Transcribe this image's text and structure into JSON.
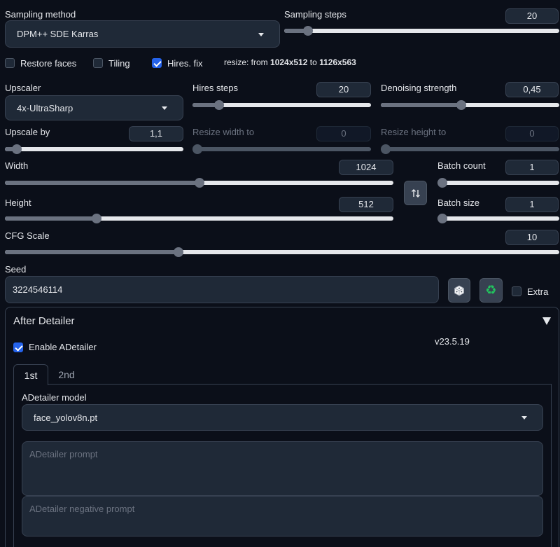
{
  "sampling": {
    "method_label": "Sampling method",
    "method_value": "DPM++ SDE Karras",
    "steps_label": "Sampling steps",
    "steps_value": "20",
    "steps_fraction": 0.07
  },
  "options": {
    "restore_faces": "Restore faces",
    "tiling": "Tiling",
    "hires_fix": "Hires. fix",
    "resize_prefix": "resize: from ",
    "resize_from": "1024x512",
    "resize_to_word": " to ",
    "resize_to": "1126x563"
  },
  "hires": {
    "upscaler_label": "Upscaler",
    "upscaler_value": "4x-UltraSharp",
    "steps_label": "Hires steps",
    "steps_value": "20",
    "steps_fraction": 0.13,
    "denoise_label": "Denoising strength",
    "denoise_value": "0,45",
    "denoise_fraction": 0.45,
    "upscale_by_label": "Upscale by",
    "upscale_by_value": "1,1",
    "upscale_by_fraction": 0.04,
    "resize_width_label": "Resize width to",
    "resize_width_value": "0",
    "resize_height_label": "Resize height to",
    "resize_height_value": "0"
  },
  "dims": {
    "width_label": "Width",
    "width_value": "1024",
    "width_fraction": 0.5,
    "height_label": "Height",
    "height_value": "512",
    "height_fraction": 0.23,
    "batch_count_label": "Batch count",
    "batch_count_value": "1",
    "batch_size_label": "Batch size",
    "batch_size_value": "1",
    "swap_icon": "swap-icon"
  },
  "cfg": {
    "label": "CFG Scale",
    "value": "10",
    "fraction": 0.31
  },
  "seed": {
    "label": "Seed",
    "value": "3224546114",
    "extra_label": "Extra",
    "dice_icon": "dice-icon",
    "recycle_icon": "recycle-icon"
  },
  "adetailer": {
    "title": "After Detailer",
    "enable_label": "Enable ADetailer",
    "version": "v23.5.19",
    "tabs": [
      "1st",
      "2nd"
    ],
    "model_label": "ADetailer model",
    "model_value": "face_yolov8n.pt",
    "prompt_placeholder": "ADetailer prompt",
    "negative_placeholder": "ADetailer negative prompt"
  }
}
